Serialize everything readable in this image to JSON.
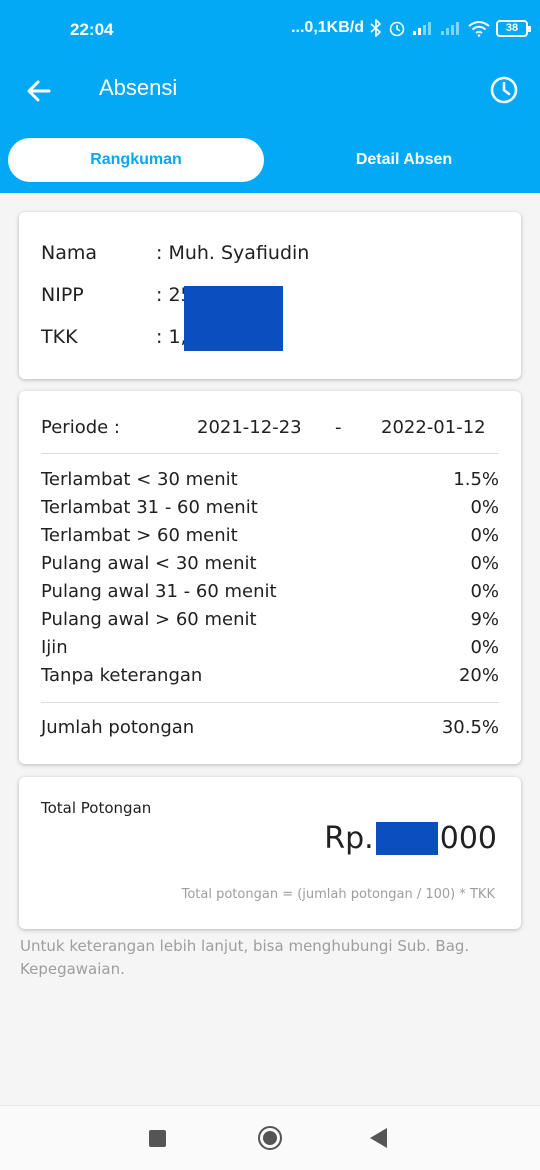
{
  "status_bar": {
    "time": "22:04",
    "net_speed": "...0,1KB/d",
    "battery": "38",
    "icons": [
      "bluetooth-icon",
      "alarm-icon",
      "signal-icon",
      "signal-icon-2",
      "wifi-icon",
      "battery-icon"
    ]
  },
  "app_bar": {
    "title": "Absensi",
    "back_icon": "arrow-left-icon",
    "history_icon": "clock-icon"
  },
  "tabs": [
    {
      "label": "Rangkuman",
      "active": true
    },
    {
      "label": "Detail Absen",
      "active": false
    }
  ],
  "profile": {
    "fields": [
      {
        "label": "Nama",
        "value": ": Muh. Syafiudin"
      },
      {
        "label": "NIPP",
        "value": ": 25"
      },
      {
        "label": "TKK",
        "value": ": 1,"
      }
    ]
  },
  "summary": {
    "period_label": "Periode :",
    "start": "2021-12-23",
    "separator": "-",
    "end": "2022-01-12",
    "rows": [
      {
        "label": "Terlambat < 30 menit",
        "value": "1.5%"
      },
      {
        "label": "Terlambat 31 - 60 menit",
        "value": "0%"
      },
      {
        "label": "Terlambat > 60 menit",
        "value": "0%"
      },
      {
        "label": "Pulang awal < 30 menit",
        "value": "0%"
      },
      {
        "label": "Pulang awal 31 - 60 menit",
        "value": "0%"
      },
      {
        "label": "Pulang awal > 60 menit",
        "value": "9%"
      },
      {
        "label": "Ijin",
        "value": "0%"
      },
      {
        "label": "Tanpa keterangan",
        "value": "20%"
      }
    ],
    "total_label": "Jumlah potongan",
    "total_value": "30.5%"
  },
  "deduction": {
    "label": "Total Potongan",
    "amount_prefix": "Rp.",
    "amount_suffix": "000",
    "formula": "Total potongan = (jumlah potongan / 100) * TKK"
  },
  "note": "Untuk keterangan lebih lanjut, bisa menghubungi Sub. Bag. Kepegawaian.",
  "colors": {
    "primary": "#03a9f4",
    "redaction": "#0b4fbf"
  }
}
